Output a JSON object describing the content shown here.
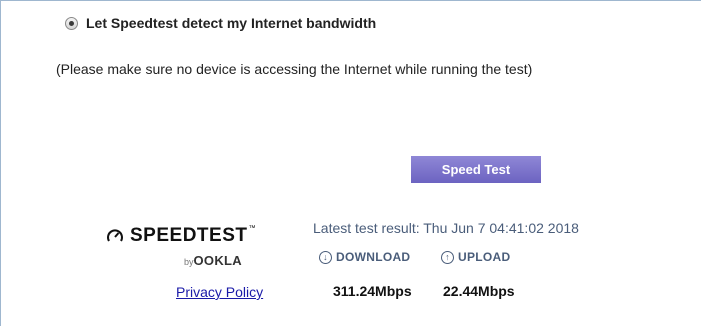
{
  "radio": {
    "label": "Let Speedtest detect my Internet bandwidth",
    "selected": true
  },
  "note": "(Please make sure no device is accessing the Internet while running the test)",
  "speed_test_button": "Speed Test",
  "brand": {
    "name": "SPEEDTEST",
    "trademark": "™",
    "by": "by",
    "ookla": "OOKLA"
  },
  "privacy_link": "Privacy Policy",
  "latest_result": "Latest test result: Thu Jun 7 04:41:02 2018",
  "download": {
    "label": "DOWNLOAD",
    "value": "311.24Mbps"
  },
  "upload": {
    "label": "UPLOAD",
    "value": "22.44Mbps"
  },
  "colors": {
    "button": "#7a72cc",
    "link": "#1a1aa8",
    "metric_label": "#4a5d7a",
    "frame_border": "#9fb7cf"
  }
}
